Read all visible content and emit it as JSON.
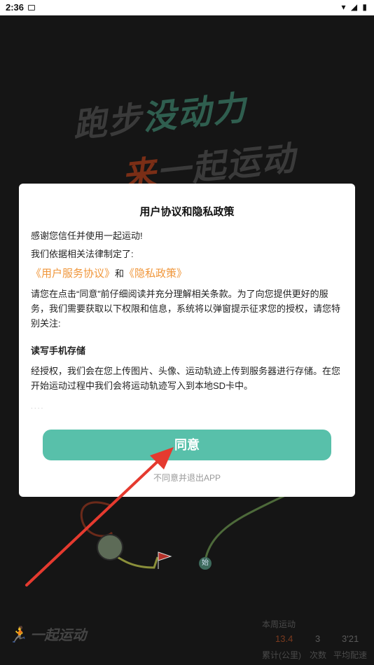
{
  "status_bar": {
    "time": "2:36",
    "right_icons": "▾ ◢ ▮"
  },
  "hero": {
    "line1_part1": "跑步",
    "line1_part2": "没动力",
    "line2_part1": "来",
    "line2_part2": "一起运动"
  },
  "dialog": {
    "title": "用户协议和隐私政策",
    "thanks": "感谢您信任并使用一起运动!",
    "intro": "我们依据相关法律制定了:",
    "link_user_agreement": "《用户服务协议》",
    "and": "和",
    "link_privacy": "《隐私政策》",
    "notice": "请您在点击“同意”前仔细阅读并充分理解相关条款。为了向您提供更好的服务，我们需要获取以下权限和信息，系统将以弹窗提示征求您的授权，请您特别关注:",
    "section_title": "读写手机存储",
    "storage_text": "经授权，我们会在您上传图片、头像、运动轨迹上传到服务器进行存储。在您开始运动过程中我们会将运动轨迹写入到本地SD卡中。",
    "cut_text": "· · · ·",
    "agree_label": "同意",
    "decline_label": "不同意并退出APP"
  },
  "map": {
    "start_marker": "始"
  },
  "footer": {
    "logo_text": "一起运动",
    "week_title": "本周运动",
    "stats": [
      {
        "value": "13.4",
        "label": "累计(公里)"
      },
      {
        "value": "3",
        "label": "次数"
      },
      {
        "value": "3'21",
        "label": "平均配速"
      }
    ]
  },
  "colors": {
    "accent_green": "#58c0aa",
    "link_orange": "#f0963a",
    "annotation_red": "#e53a2f"
  }
}
